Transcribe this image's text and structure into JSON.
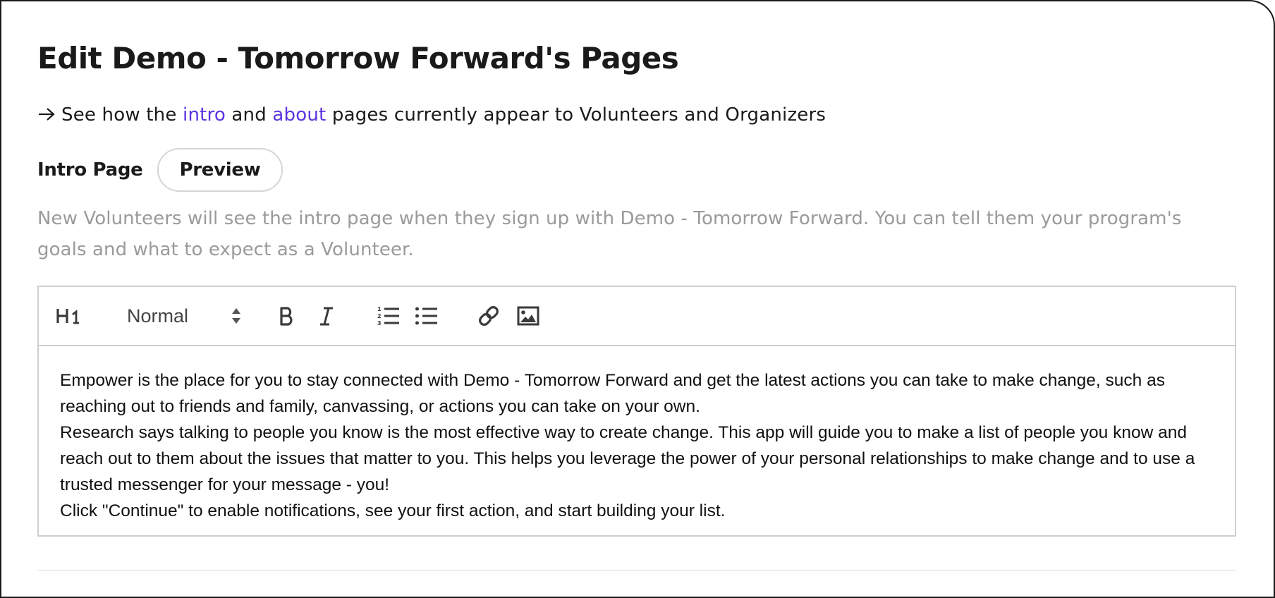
{
  "page": {
    "title": "Edit Demo - Tomorrow Forward's Pages"
  },
  "preview_line": {
    "prefix": "See how the",
    "intro_link": "intro",
    "conjunction": "and",
    "about_link": "about",
    "suffix": "pages currently appear to Volunteers and Organizers",
    "link_color": "#5a33e0",
    "icon": "arrow-right-icon"
  },
  "intro_section": {
    "label": "Intro Page",
    "preview_button": "Preview",
    "helper_text": "New Volunteers will see the intro page when they sign up with Demo - Tomorrow Forward. You can tell them your program's goals and what to expect as a Volunteer."
  },
  "toolbar": {
    "header_button": "H1",
    "format_select": {
      "selected": "Normal"
    },
    "icons": [
      "heading-1-icon",
      "select-arrows-icon",
      "bold-icon",
      "italic-icon",
      "ordered-list-icon",
      "bullet-list-icon",
      "link-icon",
      "image-icon"
    ]
  },
  "editor": {
    "paragraphs": [
      "Empower is the place for you to stay connected with Demo - Tomorrow Forward and get the latest actions you can take to make change, such as reaching out to friends and family, canvassing, or actions you can take on your own.",
      "Research says talking to people you know is the most effective way to create change. This app will guide you to make a list of people you know and reach out to them about the issues that matter to you. This helps you leverage the power of your personal relationships to make change and to use a trusted messenger for your message - you!",
      "Click \"Continue\" to enable notifications, see your first action, and start building your list."
    ]
  }
}
